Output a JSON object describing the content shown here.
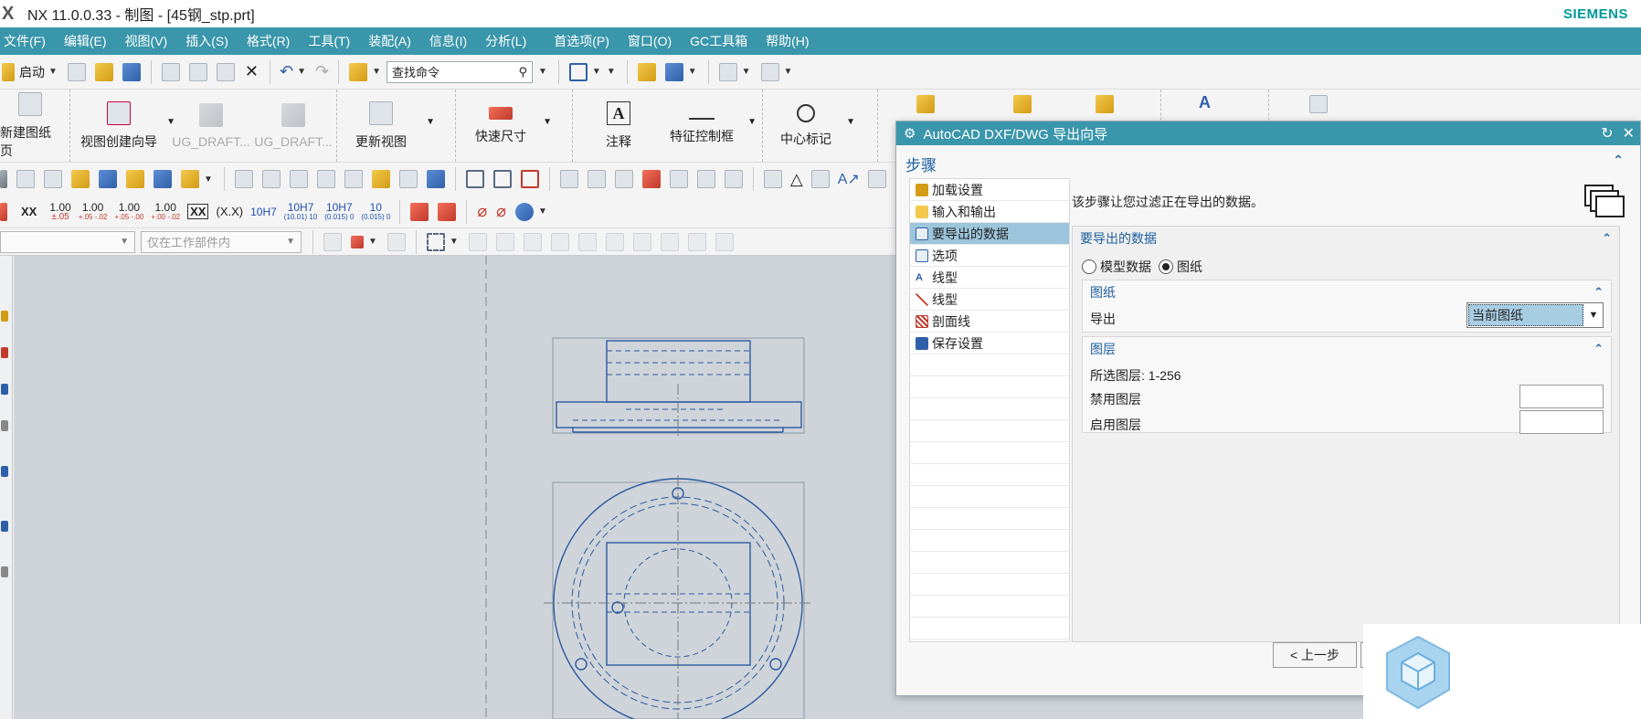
{
  "titlebar": {
    "logo": "X",
    "title": "NX 11.0.0.33 - 制图 - [45钢_stp.prt]",
    "brand": "SIEMENS"
  },
  "menu": [
    "文件(F)",
    "编辑(E)",
    "视图(V)",
    "插入(S)",
    "格式(R)",
    "工具(T)",
    "装配(A)",
    "信息(I)",
    "分析(L)",
    "首选项(P)",
    "窗口(O)",
    "GC工具箱",
    "帮助(H)"
  ],
  "toolbar1": {
    "start_label": "启动",
    "search_placeholder": "查找命令"
  },
  "toolbar2": {
    "buttons": [
      {
        "label": "新建图纸页"
      },
      {
        "label": "视图创建向导"
      },
      {
        "label": "UG_DRAFT..."
      },
      {
        "label": "UG_DRAFT..."
      },
      {
        "label": "更新视图"
      },
      {
        "label": "快速尺寸"
      },
      {
        "label": "注释"
      },
      {
        "label": "特征控制框"
      },
      {
        "label": "中心标记"
      }
    ]
  },
  "toolbar4": {
    "xx_label": "XX",
    "tolerances": [
      {
        "top": "1.00",
        "bottom": "±.05"
      },
      {
        "top": "1.00",
        "bottom": "+.05 -.02"
      },
      {
        "top": "1.00",
        "bottom": "+.05 -.00"
      },
      {
        "top": "1.00",
        "bottom": "+.00 -.02"
      }
    ],
    "boxed_xx": "XX",
    "paren_xx": "(X.X)",
    "fit1": "10H7",
    "fit2": {
      "top": "10H7",
      "bottom": "(10.01) 10"
    },
    "fit3": {
      "top": "10H7",
      "bottom": "(0.015) 0"
    },
    "fit4": {
      "top": "10",
      "bottom": "(0.015) 0"
    }
  },
  "toolbar5": {
    "combo2_placeholder": "仅在工作部件内"
  },
  "dialog": {
    "title": "AutoCAD DXF/DWG 导出向导",
    "steps_heading": "步骤",
    "steps": [
      {
        "label": "加载设置",
        "icon": "load-settings-icon",
        "selected": false
      },
      {
        "label": "输入和输出",
        "icon": "input-output-icon",
        "selected": false
      },
      {
        "label": "要导出的数据",
        "icon": "data-export-icon",
        "selected": true
      },
      {
        "label": "选项",
        "icon": "options-icon",
        "selected": false
      },
      {
        "label": "线型",
        "icon": "linetype-icon",
        "selected": false
      },
      {
        "label": "线型",
        "icon": "linetype-icon-2",
        "selected": false
      },
      {
        "label": "剖面线",
        "icon": "hatch-icon",
        "selected": false
      },
      {
        "label": "保存设置",
        "icon": "save-settings-icon",
        "selected": false
      }
    ],
    "instruction": "该步骤让您过滤正在导出的数据。",
    "section_title": "要导出的数据",
    "radio_model": "模型数据",
    "radio_drawing": "图纸",
    "radio_selected": "图纸",
    "drawing_group": {
      "title": "图纸",
      "export_label": "导出",
      "export_value": "当前图纸"
    },
    "layer_group": {
      "title": "图层",
      "selected_layers_label": "所选图层:",
      "selected_layers_value": "1-256",
      "disabled_label": "禁用图层",
      "enabled_label": "启用图层"
    },
    "back_button": "< 上一步"
  },
  "colors": {
    "menubar": "#3a96aa",
    "brand": "#009999",
    "canvas": "#ced4d9",
    "selected_step": "#9cc5dc",
    "geometry": "#2d5aa0"
  }
}
